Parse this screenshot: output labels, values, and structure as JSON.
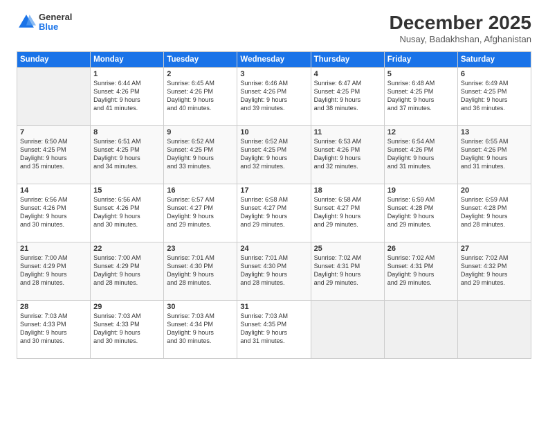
{
  "logo": {
    "general": "General",
    "blue": "Blue"
  },
  "title": "December 2025",
  "location": "Nusay, Badakhshan, Afghanistan",
  "days_header": [
    "Sunday",
    "Monday",
    "Tuesday",
    "Wednesday",
    "Thursday",
    "Friday",
    "Saturday"
  ],
  "weeks": [
    [
      {
        "day": "",
        "info": ""
      },
      {
        "day": "1",
        "info": "Sunrise: 6:44 AM\nSunset: 4:26 PM\nDaylight: 9 hours\nand 41 minutes."
      },
      {
        "day": "2",
        "info": "Sunrise: 6:45 AM\nSunset: 4:26 PM\nDaylight: 9 hours\nand 40 minutes."
      },
      {
        "day": "3",
        "info": "Sunrise: 6:46 AM\nSunset: 4:26 PM\nDaylight: 9 hours\nand 39 minutes."
      },
      {
        "day": "4",
        "info": "Sunrise: 6:47 AM\nSunset: 4:25 PM\nDaylight: 9 hours\nand 38 minutes."
      },
      {
        "day": "5",
        "info": "Sunrise: 6:48 AM\nSunset: 4:25 PM\nDaylight: 9 hours\nand 37 minutes."
      },
      {
        "day": "6",
        "info": "Sunrise: 6:49 AM\nSunset: 4:25 PM\nDaylight: 9 hours\nand 36 minutes."
      }
    ],
    [
      {
        "day": "7",
        "info": "Sunrise: 6:50 AM\nSunset: 4:25 PM\nDaylight: 9 hours\nand 35 minutes."
      },
      {
        "day": "8",
        "info": "Sunrise: 6:51 AM\nSunset: 4:25 PM\nDaylight: 9 hours\nand 34 minutes."
      },
      {
        "day": "9",
        "info": "Sunrise: 6:52 AM\nSunset: 4:25 PM\nDaylight: 9 hours\nand 33 minutes."
      },
      {
        "day": "10",
        "info": "Sunrise: 6:52 AM\nSunset: 4:25 PM\nDaylight: 9 hours\nand 32 minutes."
      },
      {
        "day": "11",
        "info": "Sunrise: 6:53 AM\nSunset: 4:26 PM\nDaylight: 9 hours\nand 32 minutes."
      },
      {
        "day": "12",
        "info": "Sunrise: 6:54 AM\nSunset: 4:26 PM\nDaylight: 9 hours\nand 31 minutes."
      },
      {
        "day": "13",
        "info": "Sunrise: 6:55 AM\nSunset: 4:26 PM\nDaylight: 9 hours\nand 31 minutes."
      }
    ],
    [
      {
        "day": "14",
        "info": "Sunrise: 6:56 AM\nSunset: 4:26 PM\nDaylight: 9 hours\nand 30 minutes."
      },
      {
        "day": "15",
        "info": "Sunrise: 6:56 AM\nSunset: 4:26 PM\nDaylight: 9 hours\nand 30 minutes."
      },
      {
        "day": "16",
        "info": "Sunrise: 6:57 AM\nSunset: 4:27 PM\nDaylight: 9 hours\nand 29 minutes."
      },
      {
        "day": "17",
        "info": "Sunrise: 6:58 AM\nSunset: 4:27 PM\nDaylight: 9 hours\nand 29 minutes."
      },
      {
        "day": "18",
        "info": "Sunrise: 6:58 AM\nSunset: 4:27 PM\nDaylight: 9 hours\nand 29 minutes."
      },
      {
        "day": "19",
        "info": "Sunrise: 6:59 AM\nSunset: 4:28 PM\nDaylight: 9 hours\nand 29 minutes."
      },
      {
        "day": "20",
        "info": "Sunrise: 6:59 AM\nSunset: 4:28 PM\nDaylight: 9 hours\nand 28 minutes."
      }
    ],
    [
      {
        "day": "21",
        "info": "Sunrise: 7:00 AM\nSunset: 4:29 PM\nDaylight: 9 hours\nand 28 minutes."
      },
      {
        "day": "22",
        "info": "Sunrise: 7:00 AM\nSunset: 4:29 PM\nDaylight: 9 hours\nand 28 minutes."
      },
      {
        "day": "23",
        "info": "Sunrise: 7:01 AM\nSunset: 4:30 PM\nDaylight: 9 hours\nand 28 minutes."
      },
      {
        "day": "24",
        "info": "Sunrise: 7:01 AM\nSunset: 4:30 PM\nDaylight: 9 hours\nand 28 minutes."
      },
      {
        "day": "25",
        "info": "Sunrise: 7:02 AM\nSunset: 4:31 PM\nDaylight: 9 hours\nand 29 minutes."
      },
      {
        "day": "26",
        "info": "Sunrise: 7:02 AM\nSunset: 4:31 PM\nDaylight: 9 hours\nand 29 minutes."
      },
      {
        "day": "27",
        "info": "Sunrise: 7:02 AM\nSunset: 4:32 PM\nDaylight: 9 hours\nand 29 minutes."
      }
    ],
    [
      {
        "day": "28",
        "info": "Sunrise: 7:03 AM\nSunset: 4:33 PM\nDaylight: 9 hours\nand 30 minutes."
      },
      {
        "day": "29",
        "info": "Sunrise: 7:03 AM\nSunset: 4:33 PM\nDaylight: 9 hours\nand 30 minutes."
      },
      {
        "day": "30",
        "info": "Sunrise: 7:03 AM\nSunset: 4:34 PM\nDaylight: 9 hours\nand 30 minutes."
      },
      {
        "day": "31",
        "info": "Sunrise: 7:03 AM\nSunset: 4:35 PM\nDaylight: 9 hours\nand 31 minutes."
      },
      {
        "day": "",
        "info": ""
      },
      {
        "day": "",
        "info": ""
      },
      {
        "day": "",
        "info": ""
      }
    ]
  ]
}
